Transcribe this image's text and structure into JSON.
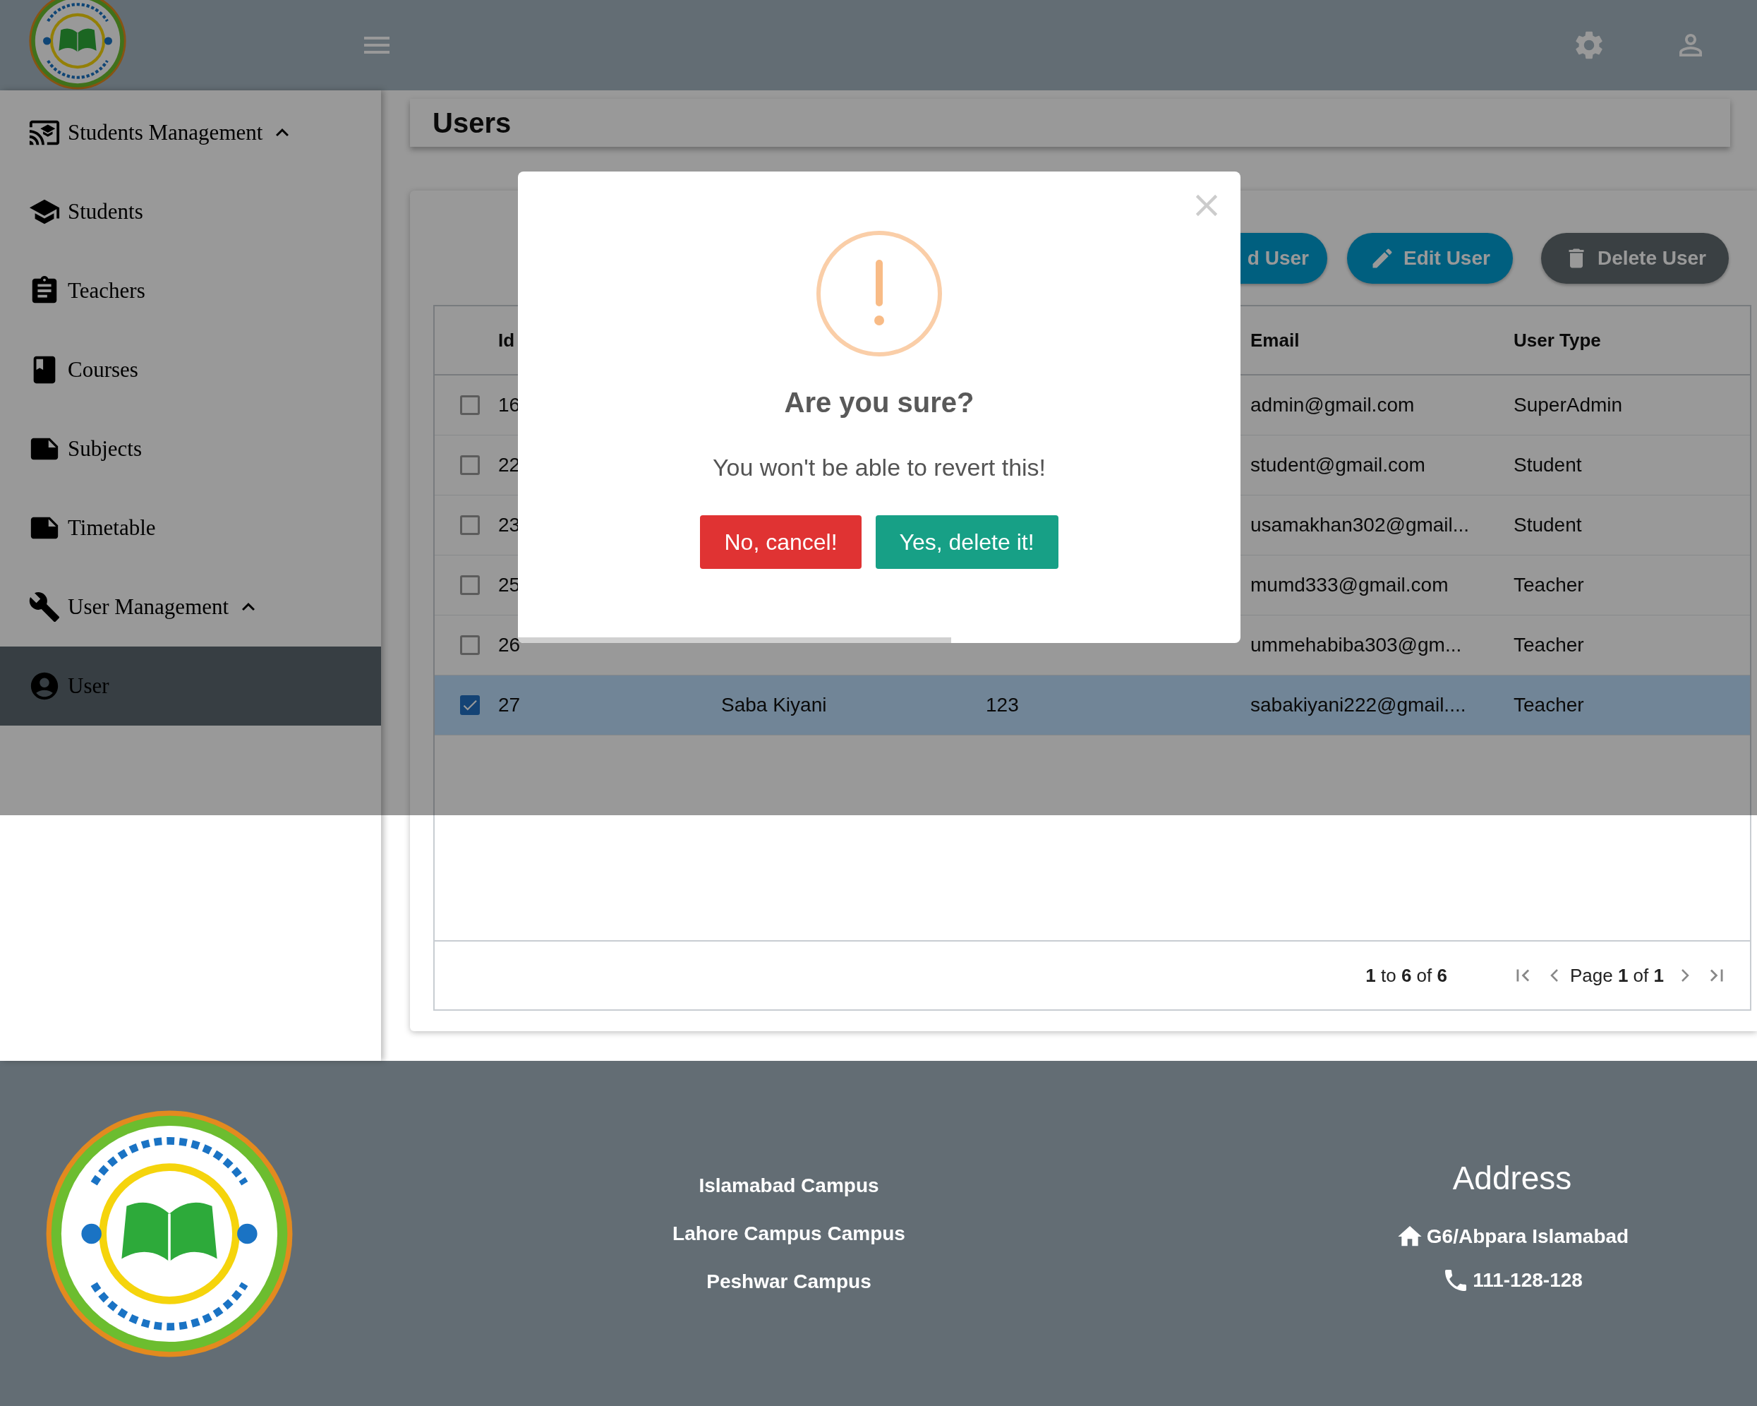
{
  "sidebar": {
    "items": [
      {
        "label": "Students Management",
        "expanded": true,
        "children": [
          {
            "label": "Students",
            "selected": false
          },
          {
            "label": "Teachers",
            "selected": false
          },
          {
            "label": "Courses",
            "selected": false
          },
          {
            "label": "Subjects",
            "selected": false
          },
          {
            "label": "Timetable",
            "selected": false
          }
        ]
      },
      {
        "label": "User Management",
        "expanded": true,
        "children": [
          {
            "label": "User",
            "selected": true
          }
        ]
      }
    ]
  },
  "page_title": "Users",
  "toolbar": {
    "buttons": [
      {
        "label": "d User",
        "kind": "add"
      },
      {
        "label": "Edit User",
        "kind": "edit"
      },
      {
        "label": "Delete User",
        "kind": "delete"
      }
    ]
  },
  "table": {
    "columns": [
      "Id",
      "Email",
      "User Type"
    ],
    "rows": [
      {
        "id": "16",
        "email": "admin@gmail.com",
        "user_type": "SuperAdmin",
        "selected": false
      },
      {
        "id": "22",
        "email": "student@gmail.com",
        "user_type": "Student",
        "selected": false
      },
      {
        "id": "23",
        "email": "usamakhan302@gmail...",
        "user_type": "Student",
        "selected": false
      },
      {
        "id": "25",
        "email": "mumd333@gmail.com",
        "user_type": "Teacher",
        "selected": false
      },
      {
        "id": "26",
        "email": "ummehabiba303@gm...",
        "user_type": "Teacher",
        "selected": false
      },
      {
        "id": "27",
        "column_2": "Saba Kiyani",
        "column_3": "123",
        "email": "sabakiyani222@gmail....",
        "user_type": "Teacher",
        "selected": true
      }
    ]
  },
  "pagination": {
    "summary": "**1** to **6** of **6**",
    "page": "Page **1** of **1**"
  },
  "dialog": {
    "title": "Are you sure?",
    "text": "You won't be able to revert this!",
    "buttons": [
      {
        "label": "No, cancel!",
        "kind": "cancel"
      },
      {
        "label": "Yes, delete it!",
        "kind": "confirm"
      }
    ],
    "timer": {
      "level": 0.6
    }
  },
  "footer": {
    "campuses": [
      "Islamabad Campus",
      "Lahore Campus Campus",
      "Peshwar Campus"
    ],
    "address": {
      "title": "Address",
      "lines": [
        {
          "kind": "home",
          "text": "G6/Abpara Islamabad"
        },
        {
          "kind": "phone",
          "text": "111-128-128"
        }
      ]
    }
  }
}
